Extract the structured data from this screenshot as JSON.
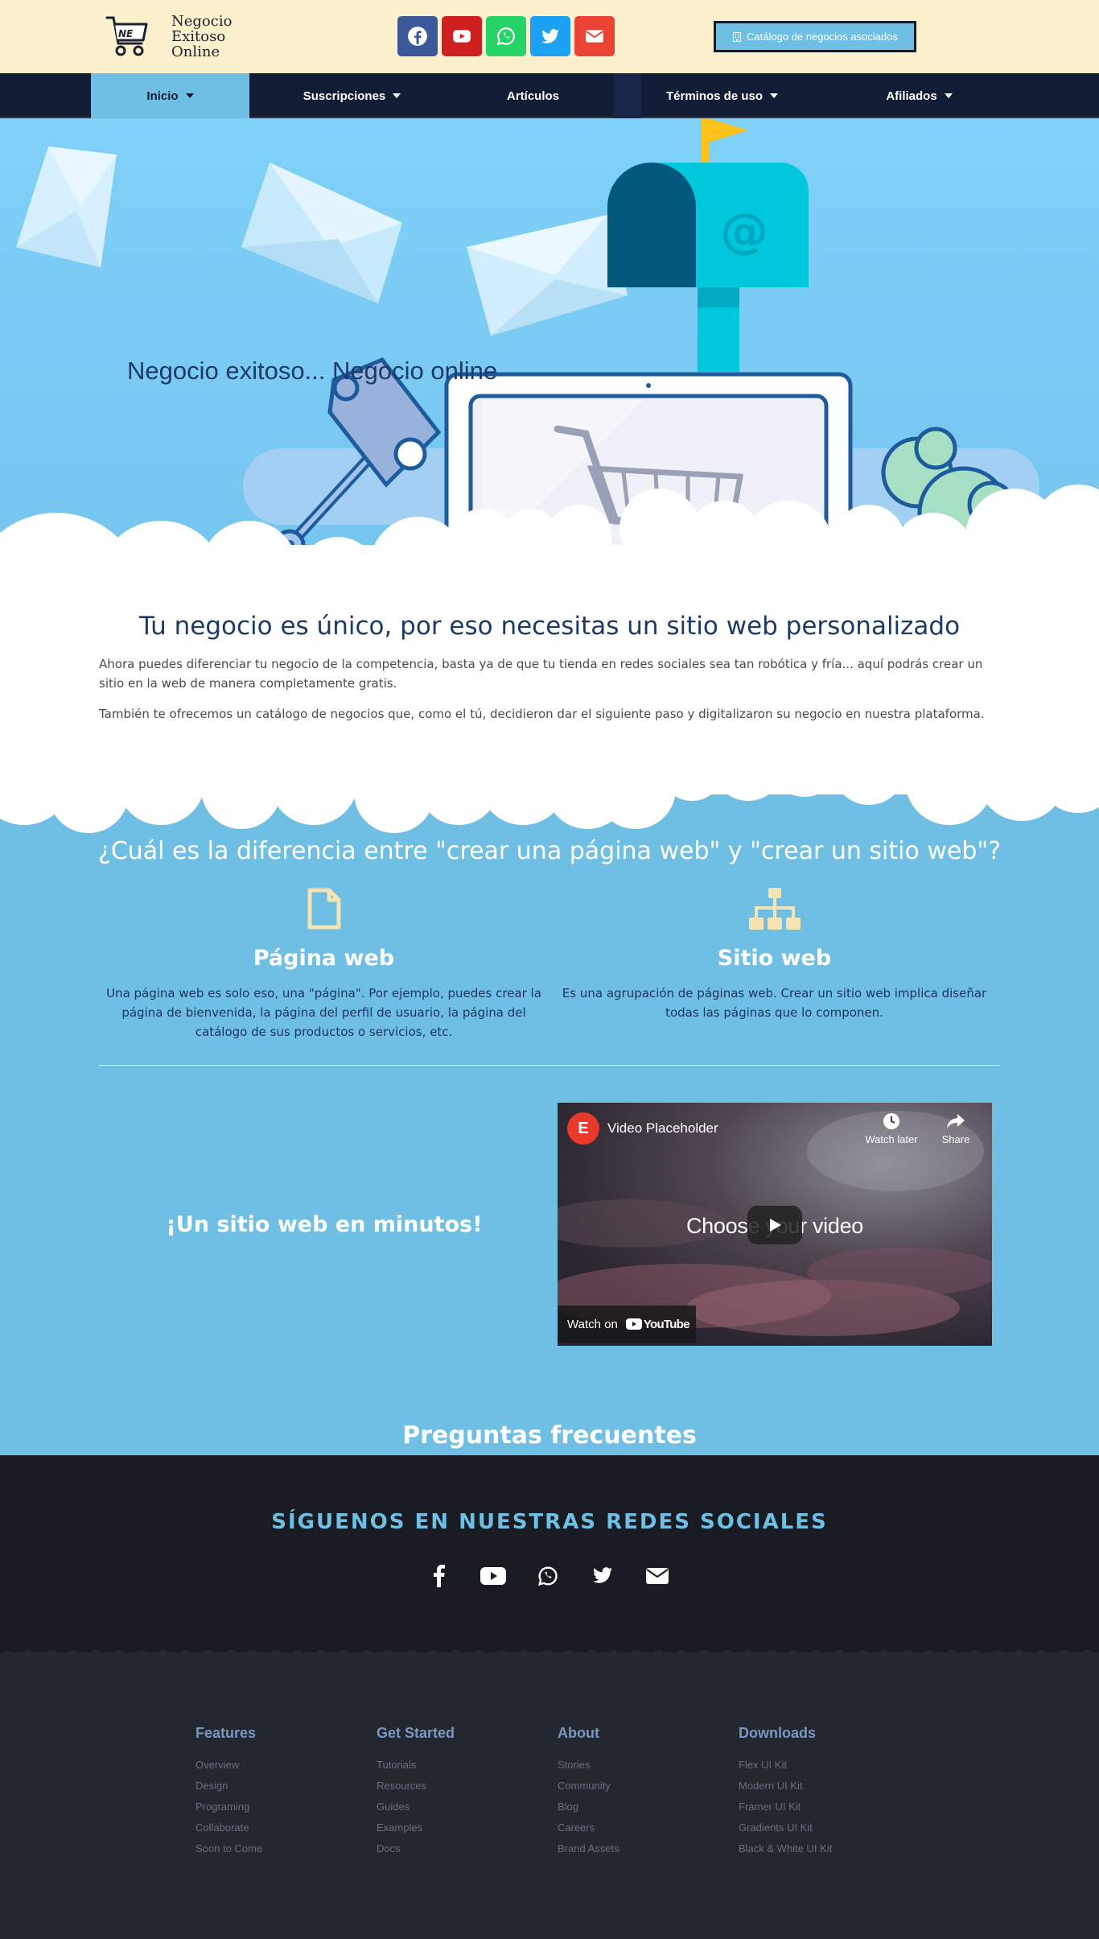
{
  "brand": {
    "line1": "Negocio",
    "line2": "Exitoso",
    "line3": "Online",
    "logo_mark": "NE"
  },
  "top_social": [
    {
      "icon": "facebook-icon",
      "color": "#3b5998"
    },
    {
      "icon": "youtube-icon",
      "color": "#cd201f"
    },
    {
      "icon": "whatsapp-icon",
      "color": "#25d366"
    },
    {
      "icon": "twitter-icon",
      "color": "#1da1f2"
    },
    {
      "icon": "envelope-icon",
      "color": "#ea4335"
    }
  ],
  "catalog_button": {
    "label": "Catálogo de negocios asociados",
    "icon": "building-icon"
  },
  "nav": {
    "items": [
      {
        "label": "Inicio",
        "dropdown": true,
        "active": true
      },
      {
        "label": "Suscripciones",
        "dropdown": true
      },
      {
        "label": "Artículos",
        "dropdown": false
      },
      {
        "label": "Términos de uso",
        "dropdown": true
      },
      {
        "label": "Afiliados",
        "dropdown": true
      }
    ],
    "active_color": "#6fbfe5"
  },
  "hero": {
    "title": "Negocio exitoso... Negocio online"
  },
  "intro": {
    "title": "Tu negocio es único, por eso necesitas un sitio web personalizado",
    "paragraph1": "Ahora puedes diferenciar tu negocio de la competencia, basta ya de que tu tienda en redes sociales sea tan robótica y fría... aquí podrás crear un sitio en la web de manera completamente gratis.",
    "paragraph2": "También te ofrecemos un catálogo de negocios que, como el tú, decidieron dar el siguiente paso y digitalizaron su negocio en nuestra plataforma."
  },
  "difference": {
    "title": "¿Cuál es la diferencia entre \"crear una página web\" y \"crear un sitio web\"?",
    "page": {
      "icon": "file-icon",
      "title": "Página web",
      "text": "Una página web es solo eso, una \"página\". Por ejemplo, puedes crear la página de bienvenida, la página del perfil de usuario, la página del catálogo de sus productos o servicios, etc."
    },
    "site": {
      "icon": "sitemap-icon",
      "title": "Sitio web",
      "text": "Es una agrupación de páginas web. Crear un sitio web implica diseñar todas las páginas que lo componen."
    }
  },
  "video_section": {
    "title": "¡Un sitio web en minutos!"
  },
  "video": {
    "channel_badge": "E",
    "title": "Video Placeholder",
    "watch_later": "Watch later",
    "share": "Share",
    "center_text_1": "Choose ",
    "center_text_2": "your",
    "center_text_3": " video",
    "watch_on": "Watch on",
    "youtube": "YouTube"
  },
  "faq": {
    "title": "Preguntas frecuentes"
  },
  "follow": {
    "title": "SÍGUENOS EN NUESTRAS REDES SOCIALES",
    "icons": [
      "facebook-icon",
      "youtube-icon",
      "whatsapp-icon",
      "twitter-icon",
      "envelope-icon"
    ]
  },
  "footer": {
    "columns": [
      {
        "title": "Features",
        "links": [
          "Overview",
          "Design",
          "Programing",
          "Collaborate",
          "Soon to Come"
        ]
      },
      {
        "title": "Get Started",
        "links": [
          "Tutorials",
          "Resources",
          "Guides",
          "Examples",
          "Docs"
        ]
      },
      {
        "title": "About",
        "links": [
          "Stories",
          "Community",
          "Blog",
          "Careers",
          "Brand Assets"
        ]
      },
      {
        "title": "Downloads",
        "links": [
          "Flex UI Kit",
          "Modern UI Kit",
          "Framer UI Kit",
          "Gradients UI Kit",
          "Black & White UI Kit"
        ]
      }
    ]
  }
}
